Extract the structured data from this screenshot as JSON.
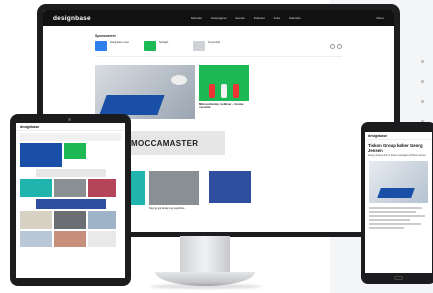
{
  "desktop": {
    "logo": "designbase",
    "nav": [
      "Nyheder",
      "Kampagner",
      "Events",
      "Podcast",
      "Jobs",
      "Kalender"
    ],
    "menu_label": "Menu",
    "sponsored_label": "Sponsoreret",
    "sponsored_items": [
      "Designbase news",
      "Spotlight",
      "Nyt produkt"
    ],
    "hero_side_caption": "Mikroomhelmp, bolibner – Invoke ovenstal",
    "banner_brand": "MOCCAMASTER",
    "card_captions": [
      "Dansk Inn Danes hier bekab",
      "Spyngt gik design og tegnibres"
    ]
  },
  "tablet": {
    "logo": "designbase"
  },
  "phone": {
    "logo": "designbase",
    "headline": "Tiskon Group køber Georg Jensen",
    "subline": "Georg Jensen A/S er blevet overtaget af Tiskon Group"
  },
  "colors": {
    "header": "#111111",
    "hero_blue": "#1a4fa8",
    "green": "#1db954"
  }
}
